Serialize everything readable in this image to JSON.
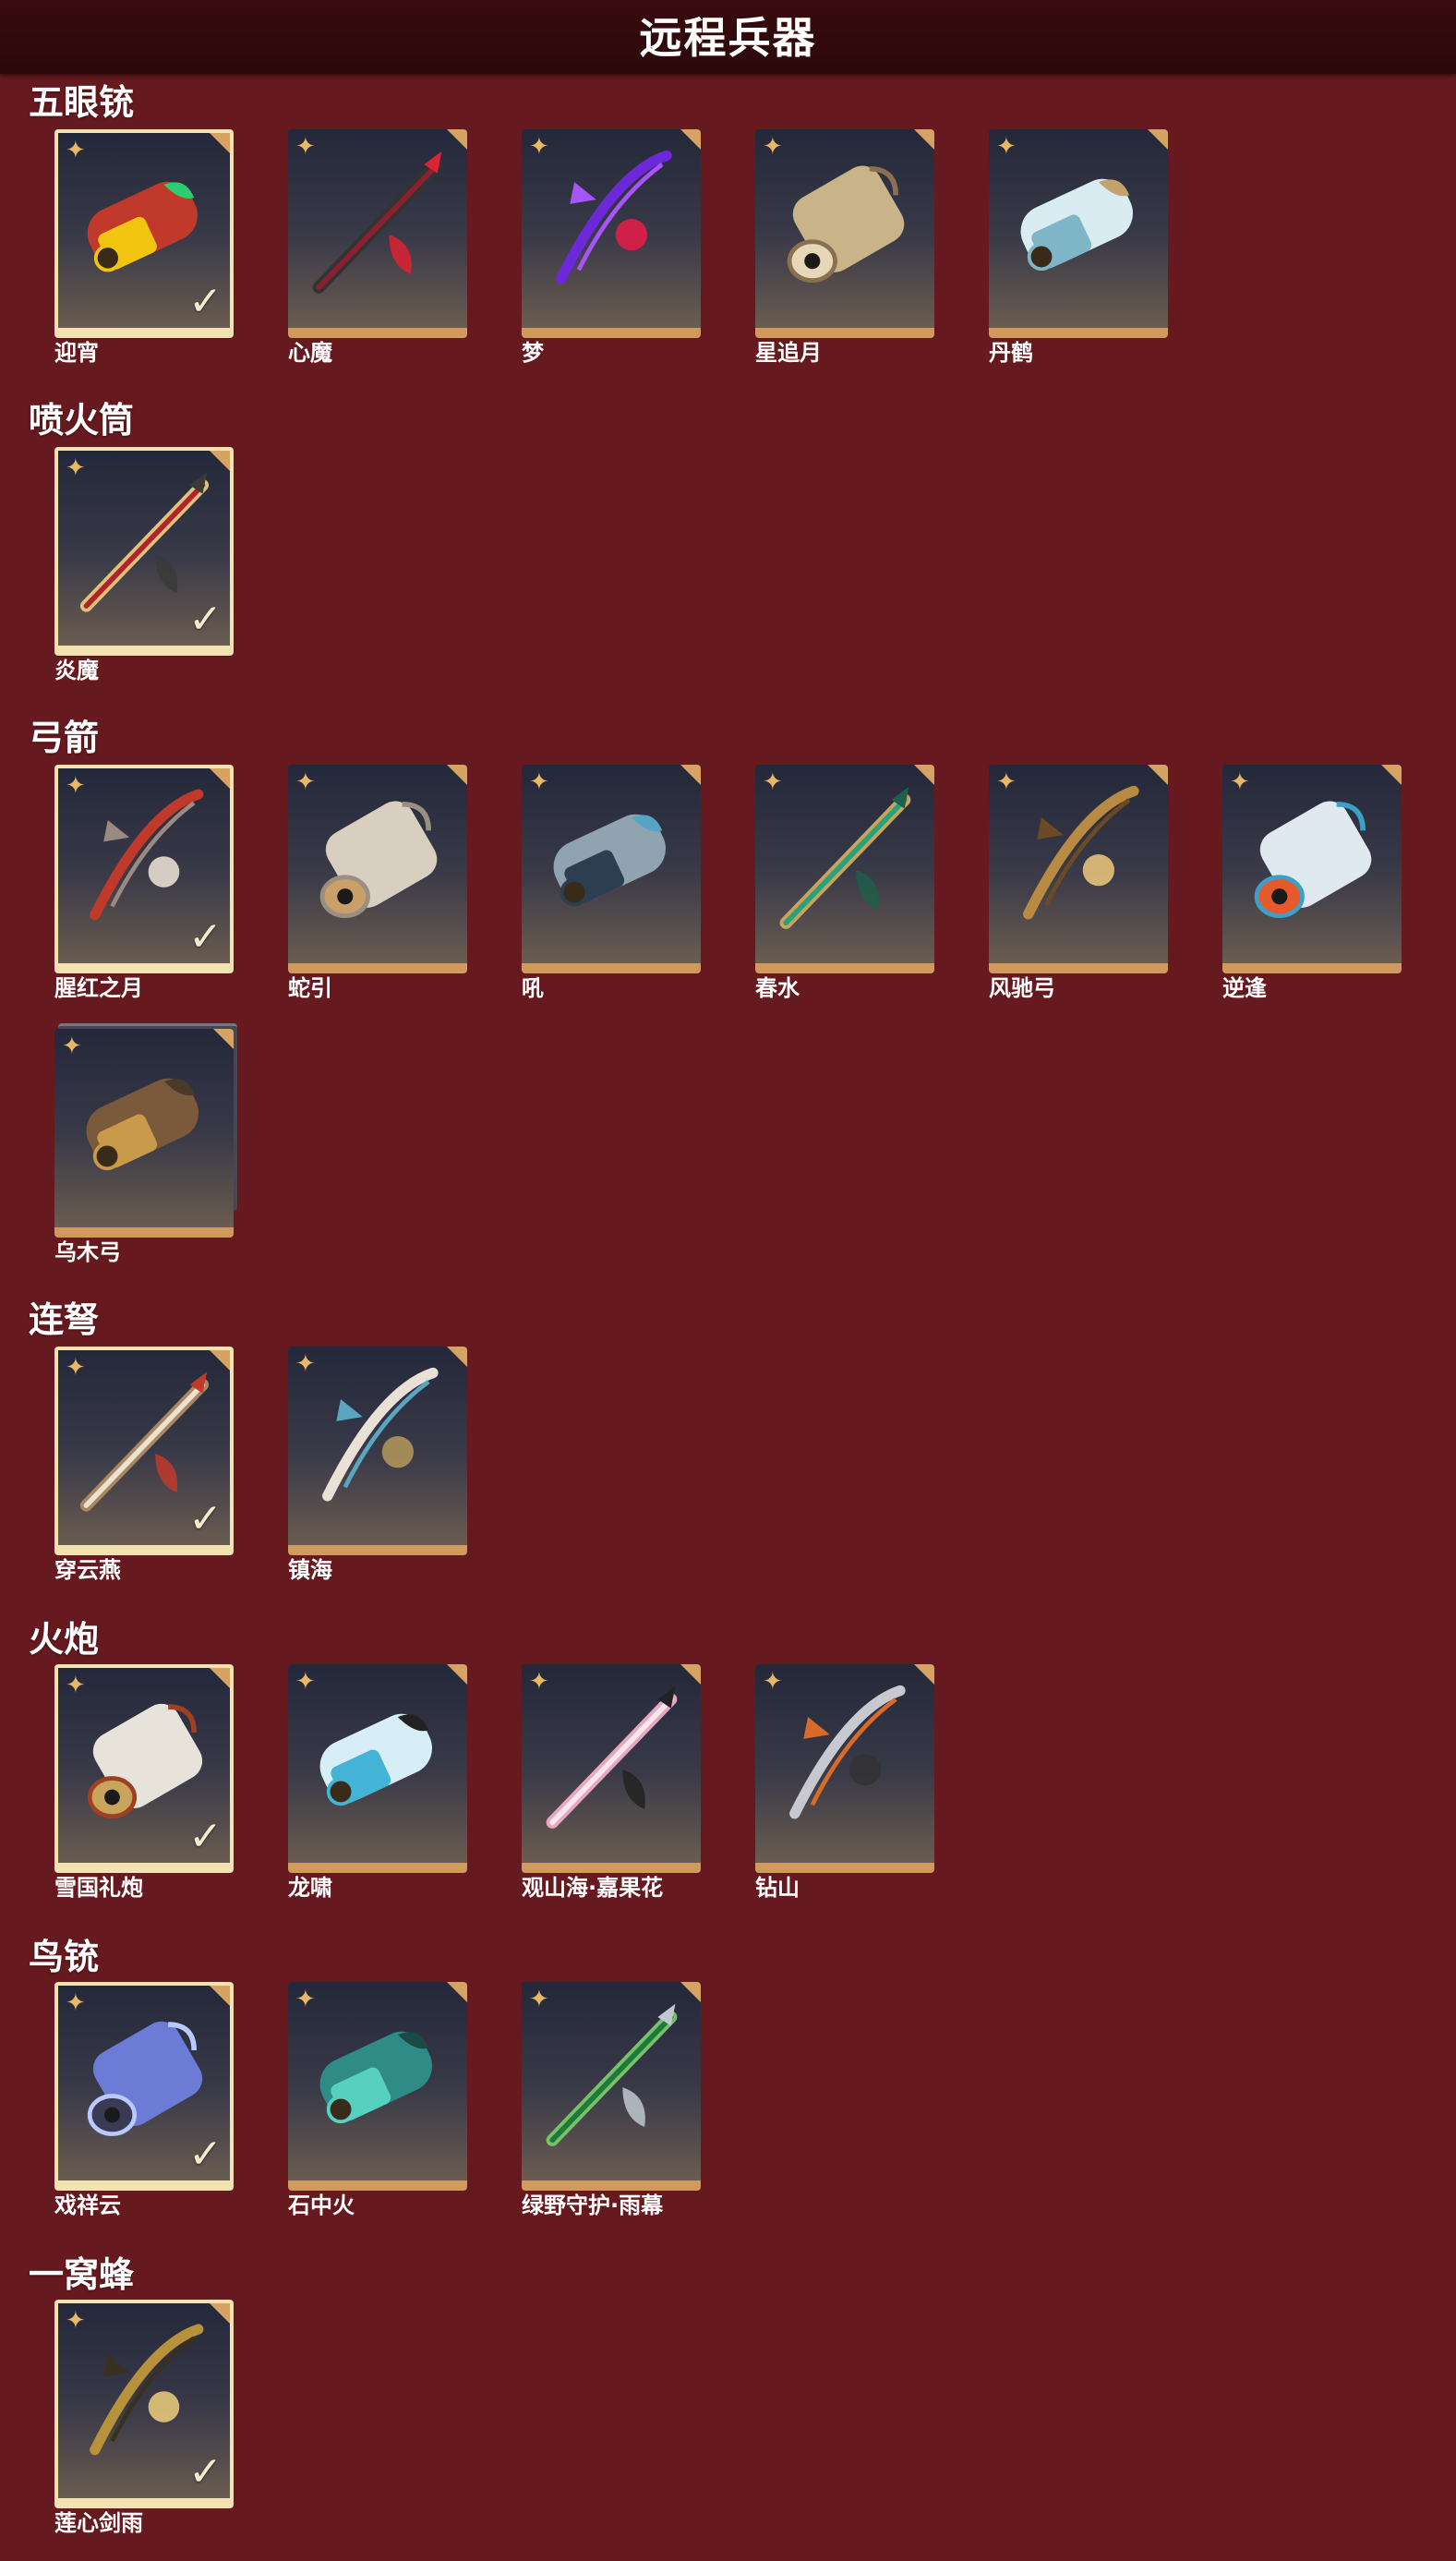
{
  "header": {
    "title": "远程兵器"
  },
  "icons": {
    "quality": "star-icon",
    "equipped": "checkmark-icon"
  },
  "colors": {
    "background": "#66191e",
    "header": "#2b080a",
    "card_border_equipped": "#f3e3b3",
    "card_bottom": "#cf9a5c",
    "quality_star": "#e8b865"
  },
  "sections": [
    {
      "title": "五眼铳",
      "items": [
        {
          "name": "迎宵",
          "equipped": true
        },
        {
          "name": "心魔",
          "equipped": false
        },
        {
          "name": "梦",
          "equipped": false
        },
        {
          "name": "星追月",
          "equipped": false
        },
        {
          "name": "丹鹤",
          "equipped": false
        }
      ]
    },
    {
      "title": "喷火筒",
      "items": [
        {
          "name": "炎魔",
          "equipped": true
        }
      ]
    },
    {
      "title": "弓箭",
      "items": [
        {
          "name": "腥红之月",
          "equipped": true
        },
        {
          "name": "蛇引",
          "equipped": false
        },
        {
          "name": "吼",
          "equipped": false
        },
        {
          "name": "春水",
          "equipped": false
        },
        {
          "name": "风驰弓",
          "equipped": false
        },
        {
          "name": "逆逢",
          "equipped": false
        },
        {
          "name": "乌木弓",
          "equipped": false
        }
      ]
    },
    {
      "title": "连弩",
      "items": [
        {
          "name": "穿云燕",
          "equipped": true
        },
        {
          "name": "镇海",
          "equipped": false
        }
      ]
    },
    {
      "title": "火炮",
      "items": [
        {
          "name": "雪国礼炮",
          "equipped": true
        },
        {
          "name": "龙啸",
          "equipped": false
        },
        {
          "name": "观山海·嘉果花",
          "equipped": false
        },
        {
          "name": "钻山",
          "equipped": false
        }
      ]
    },
    {
      "title": "鸟铳",
      "items": [
        {
          "name": "戏祥云",
          "equipped": true
        },
        {
          "name": "石中火",
          "equipped": false
        },
        {
          "name": "绿野守护·雨幕",
          "equipped": false
        }
      ]
    },
    {
      "title": "一窝蜂",
      "items": [
        {
          "name": "莲心剑雨",
          "equipped": true
        }
      ]
    }
  ]
}
